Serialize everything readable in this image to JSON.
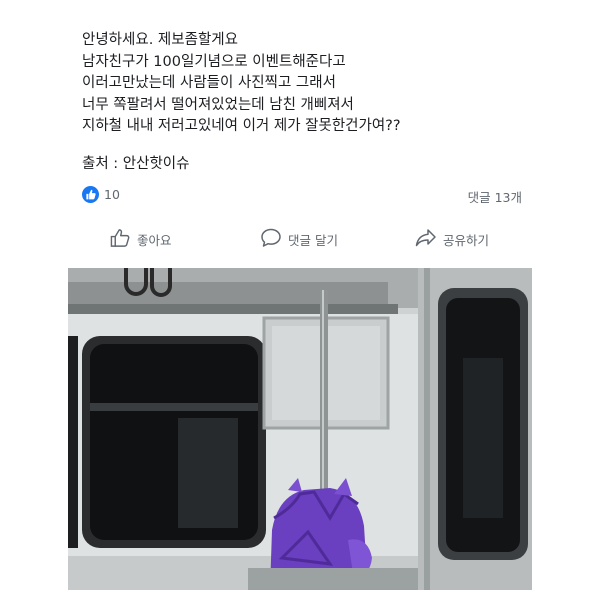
{
  "post": {
    "lines": [
      "안녕하세요. 제보좀할게요",
      "남자친구가 100일기념으로 이벤트해준다고",
      "이러고만났는데 사람들이 사진찍고 그래서",
      "너무 쪽팔려서 떨어져있었는데 남친 개삐져서",
      "지하철 내내 저러고있네여 이거 제가 잘못한건가여??"
    ],
    "source": "출처 : 안산핫이슈"
  },
  "reactions": {
    "like_count": "10",
    "comment_count": "댓글 13개"
  },
  "actions": {
    "like_label": "좋아요",
    "comment_label": "댓글 달기",
    "share_label": "공유하기"
  },
  "colors": {
    "facebook_blue": "#1877f2",
    "action_gray": "#606770",
    "costume_purple": "#6a3fc0"
  },
  "icons": {
    "like_badge": "thumbs-up-icon",
    "like_action": "thumbs-up-outline-icon",
    "comment_action": "speech-bubble-icon",
    "share_action": "share-arrow-icon"
  },
  "photo": {
    "subject": "subway-car-interior-with-purple-costume"
  }
}
